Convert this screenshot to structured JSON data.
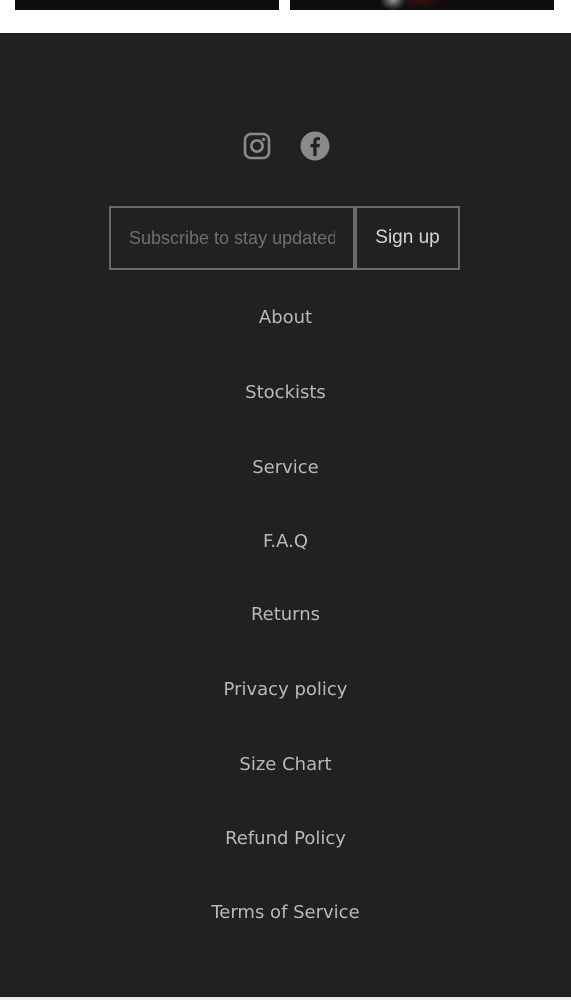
{
  "footer": {
    "social": [
      {
        "name": "instagram-icon"
      },
      {
        "name": "facebook-icon"
      }
    ],
    "subscribe": {
      "placeholder": "Subscribe to stay updated",
      "button_label": "Sign up"
    },
    "links": [
      {
        "label": "About"
      },
      {
        "label": "Stockists"
      },
      {
        "label": "Service"
      },
      {
        "label": "F.A.Q"
      },
      {
        "label": "Returns"
      },
      {
        "label": "Privacy policy"
      },
      {
        "label": "Size Chart"
      },
      {
        "label": "Refund Policy"
      },
      {
        "label": "Terms of Service"
      }
    ]
  }
}
